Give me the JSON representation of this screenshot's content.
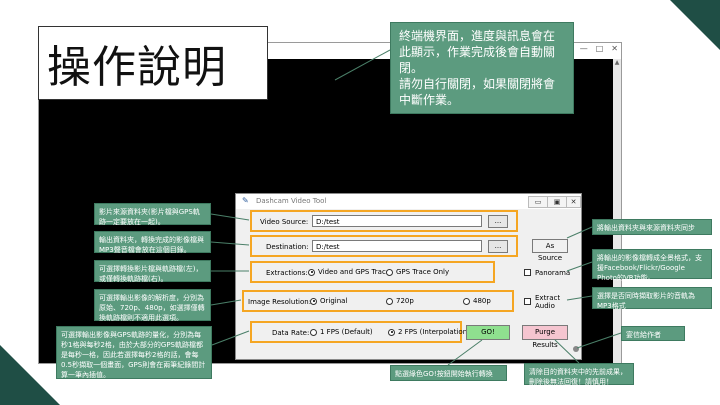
{
  "slide": {
    "title": "操作說明",
    "colors": {
      "note_bg": "#5c9b7f",
      "highlight": "#f5a623",
      "corner": "#1f4e45",
      "go_button": "#8fe08f",
      "purge_button": "#f5c5d0"
    }
  },
  "terminal": {
    "note": "終端機界面，進度與訊息會在此顯示，作業完成後會自動關閉。\n請勿自行關閉，如果關閉將會中斷作業。",
    "controls": [
      "—",
      "□",
      "✕"
    ]
  },
  "tool": {
    "title": "Dashcam Video Tool",
    "window_controls": [
      "▭",
      "▣",
      "✕"
    ],
    "video_source": {
      "label": "Video Source:",
      "value": "D:/test",
      "browse": "..."
    },
    "destination": {
      "label": "Destination:",
      "value": "D:/test",
      "browse": "..."
    },
    "as_source_button": "As Source",
    "extractions": {
      "label": "Extractions:",
      "options": [
        "Video and GPS Trace",
        "GPS Trace Only"
      ],
      "selected": "Video and GPS Trace"
    },
    "panorama": {
      "label": "Panorama",
      "checked": false
    },
    "resolution": {
      "label": "Image Resolution:",
      "options": [
        "Original",
        "720p",
        "480p"
      ],
      "selected": "Original"
    },
    "extract_audio": {
      "label": "Extract Audio",
      "checked": false
    },
    "data_rate": {
      "label": "Data Rate:",
      "options": [
        "1 FPS (Default)",
        "2 FPS (Interpolation)"
      ],
      "selected": "2 FPS (Interpolation)"
    },
    "go_button": "GO!",
    "purge_button": "Purge Results"
  },
  "notes": {
    "video_source": "影片來源資料夾(影片檔與GPS軌跡一定要放在一起)。",
    "destination": "輸出資料夾，轉換完成的影像檔與MP3聲音檔會放在這個目錄。",
    "extractions": "可選擇轉換影片檔與軌跡檔(左)，或僅轉換軌跡檔(右)。",
    "resolution": "可選擇輸出影像的解析度，分別為原始、720p、480p，如選擇僅轉換軌跡檔則不適用此選項。",
    "data_rate": "可選擇輸出影像與GPS軌跡的量化，分別為每秒1格與每秒2格，由於大部分的GPS軌跡檔都是每秒一格，因此若選擇每秒2格的話，會每0.5秒擷取一個畫面，GPS則會在兩筆紀錄間計算一筆內插值。",
    "as_source": "將輸出資料夾與來源資料夾同步",
    "panorama": "將輸出的影像檔轉成全景格式，支援Facebook/Flickr/Google Photo的VR功能。",
    "extract_audio": "選擇是否同時擷取影片的音軌為MP3格式",
    "status": "宴信給作者",
    "go": "點選綠色GO!按鈕開始執行轉換",
    "purge": "清除目的資料夾中的先前成果，刪除後無法回復！請慎用！"
  }
}
